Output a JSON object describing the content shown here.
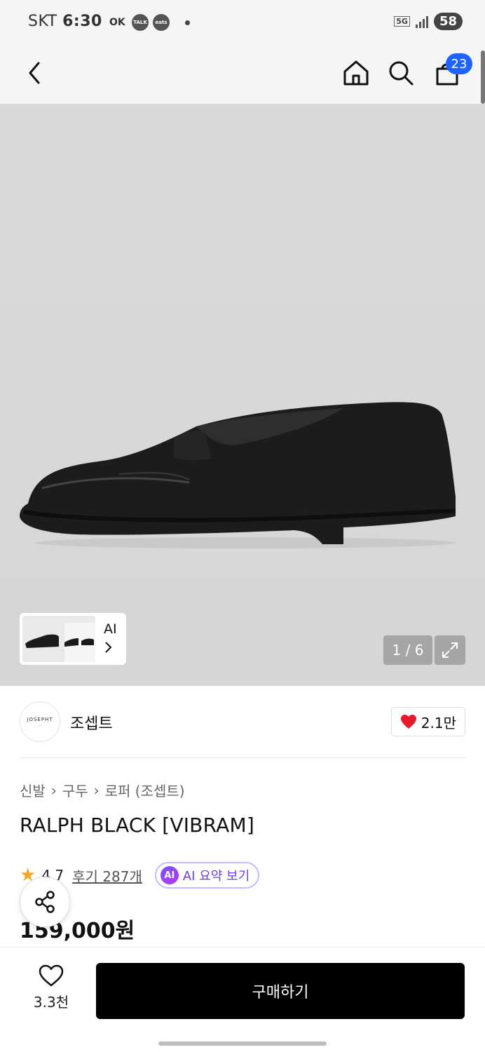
{
  "status_bar": {
    "carrier": "SKT",
    "time": "6:30",
    "ok_icon": "OK",
    "talk_icon": "TALK",
    "eats_icon": "eats",
    "network": "5G",
    "battery": "58"
  },
  "nav": {
    "cart_count": "23"
  },
  "gallery": {
    "thumb_label": "AI",
    "counter": "1 / 6"
  },
  "brand": {
    "logo_text": "JOSEPHT",
    "name": "조셉트",
    "like_count": "2.1만"
  },
  "breadcrumb": {
    "items": [
      "신발",
      "구두",
      "로퍼 (조셉트)"
    ]
  },
  "product": {
    "title": "RALPH BLACK [VIBRAM]",
    "rating": "4.7",
    "reviews": "후기 287개",
    "ai_badge": "AI",
    "ai_summary": "AI 요약 보기",
    "price": "159,000원"
  },
  "bottom_bar": {
    "wish_count": "3.3천",
    "buy_label": "구매하기"
  },
  "colors": {
    "badge_blue": "#1e63ff",
    "heart_red": "#e8192c",
    "star_orange": "#f5a623",
    "ai_purple": "#6a3de8"
  }
}
